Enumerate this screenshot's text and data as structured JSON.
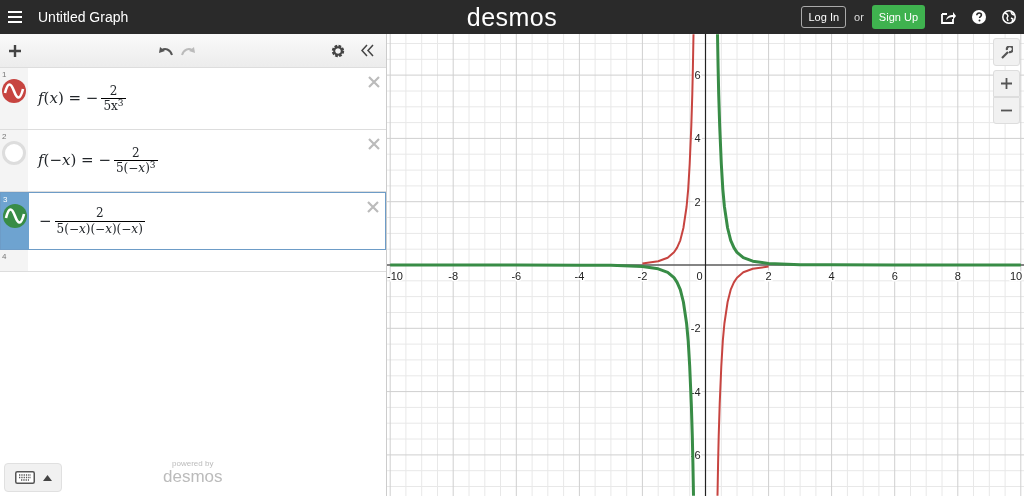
{
  "header": {
    "title": "Untitled Graph",
    "logo": "desmos",
    "login": "Log In",
    "or": "or",
    "signup": "Sign Up"
  },
  "expressions": [
    {
      "number": "1",
      "visible": true,
      "color": "#c74440",
      "selected": false,
      "lhs": "*f*(*x*) = −",
      "numerator": "2",
      "denominator": "5x$^{3}$"
    },
    {
      "number": "2",
      "visible": false,
      "selected": false,
      "lhs": "*f*(−*x*) = −",
      "numerator": "2",
      "denominator": "5(−*x*)$^{3}$"
    },
    {
      "number": "3",
      "visible": true,
      "color": "#388c46",
      "selected": true,
      "lhs": "−",
      "numerator": "2",
      "denominator": "5(−*x*)(−*x*)(−*x*)"
    },
    {
      "number": "4",
      "selected": false
    }
  ],
  "footer": {
    "powered_by": "powered by",
    "brand": "desmos"
  },
  "graph": {
    "chart_data": {
      "type": "line",
      "grid": true,
      "xlim": [
        -10.1,
        10.1
      ],
      "ylim": [
        -7.3,
        7.3
      ],
      "xticks": [
        -10,
        -8,
        -6,
        -4,
        -2,
        0,
        2,
        4,
        6,
        8,
        10
      ],
      "yticks": [
        -6,
        -4,
        -2,
        2,
        4,
        6
      ],
      "x": [
        -10,
        -6,
        -4,
        -3,
        -2,
        -1.5,
        -1.2,
        -1,
        -0.9,
        -0.8,
        -0.7,
        -0.6,
        -0.55,
        -0.5,
        -0.45,
        -0.42,
        -0.4,
        -0.38,
        0,
        0.38,
        0.4,
        0.42,
        0.45,
        0.5,
        0.55,
        0.6,
        0.7,
        0.8,
        0.9,
        1,
        1.2,
        1.5,
        2,
        3,
        4,
        6,
        10
      ],
      "series": [
        {
          "color": "#c74440",
          "values": [
            null,
            null,
            null,
            null,
            0.05,
            0.12,
            0.23,
            0.4,
            0.55,
            0.78,
            1.17,
            1.85,
            2.4,
            3.2,
            4.39,
            5.4,
            6.25,
            7.29,
            null,
            -7.29,
            -6.25,
            -5.4,
            -4.39,
            -3.2,
            -2.4,
            -1.85,
            -1.17,
            -0.78,
            -0.55,
            -0.4,
            -0.23,
            -0.12,
            -0.05,
            null,
            null,
            null,
            null
          ]
        },
        {
          "color": "#388c46",
          "values": [
            0,
            0,
            -0.01,
            -0.01,
            -0.05,
            -0.12,
            -0.23,
            -0.4,
            -0.55,
            -0.78,
            -1.17,
            -1.85,
            -2.4,
            -3.2,
            -4.39,
            -5.4,
            -6.25,
            -7.29,
            null,
            7.29,
            6.25,
            5.4,
            4.39,
            3.2,
            2.4,
            1.85,
            1.17,
            0.78,
            0.55,
            0.4,
            0.23,
            0.12,
            0.05,
            0.01,
            0.01,
            0,
            0
          ]
        }
      ]
    }
  }
}
